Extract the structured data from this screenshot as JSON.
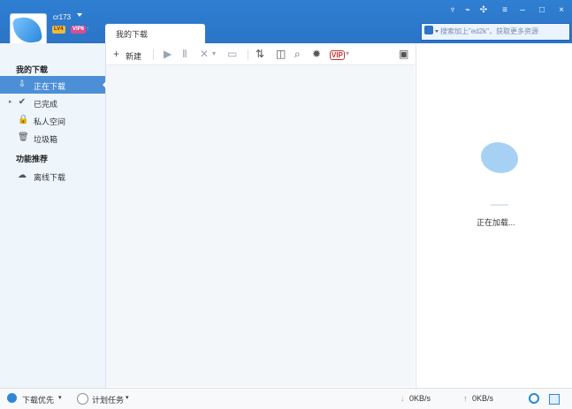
{
  "app": {
    "username": "cr173",
    "level_badge": "LV4",
    "vip_badge": "VIP6",
    "tab_title": "我的下载",
    "search_placeholder": "搜索加上\"ed2k\"，获取更多资源"
  },
  "sidebar": {
    "section1_title": "我的下载",
    "items": [
      {
        "label": "正在下载",
        "icon": "download-icon",
        "active": true
      },
      {
        "label": "已完成",
        "icon": "check-icon",
        "active": false
      },
      {
        "label": "私人空间",
        "icon": "lock-icon",
        "active": false
      },
      {
        "label": "垃圾箱",
        "icon": "trash-icon",
        "active": false
      }
    ],
    "section2_title": "功能推荐",
    "section2_items": [
      {
        "label": "离线下载",
        "icon": "cloud-download-icon"
      }
    ]
  },
  "toolbar": {
    "new_label": "新建",
    "icons": [
      "plus-icon",
      "play-icon",
      "pause-icon",
      "delete-icon",
      "folder-icon",
      "sort-icon",
      "details-icon",
      "search-icon",
      "settings-icon",
      "vip-icon",
      "lock-box-icon"
    ]
  },
  "right_panel": {
    "loading_text": "正在加载..."
  },
  "status": {
    "priority_label": "下载优先",
    "plan_label": "计划任务",
    "download_speed": "0KB/s",
    "upload_speed": "0KB/s"
  }
}
